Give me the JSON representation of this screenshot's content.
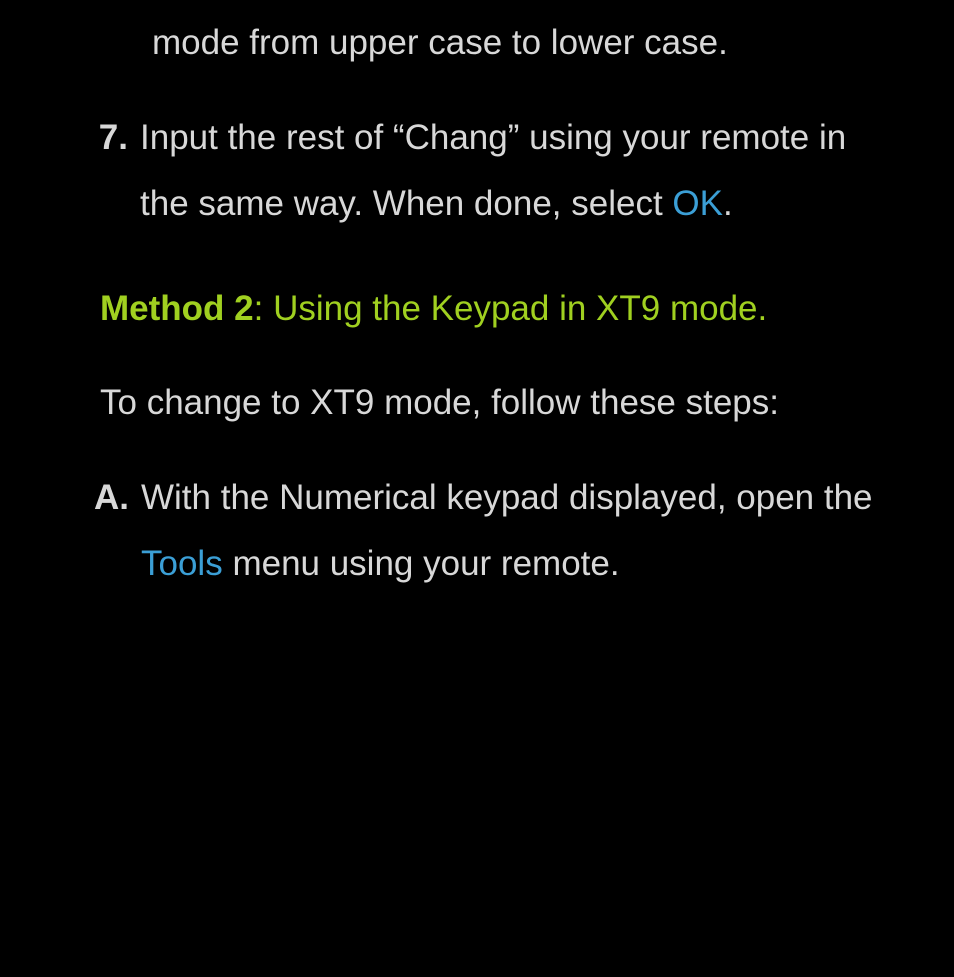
{
  "partial_line": "mode from upper case to lower case.",
  "step7": {
    "marker": "7.",
    "text_before": "Input the rest of “Chang” using your remote in the same way. When done, select ",
    "ok_label": "OK",
    "text_after": "."
  },
  "method2": {
    "label": "Method 2",
    "separator": ": ",
    "title": "Using the Keypad in XT9 mode."
  },
  "intro_text": "To change to XT9 mode, follow these steps:",
  "stepA": {
    "marker": "A.",
    "text_before": "With the Numerical keypad displayed, open the ",
    "tools_label": "Tools",
    "text_after": " menu using your remote."
  }
}
